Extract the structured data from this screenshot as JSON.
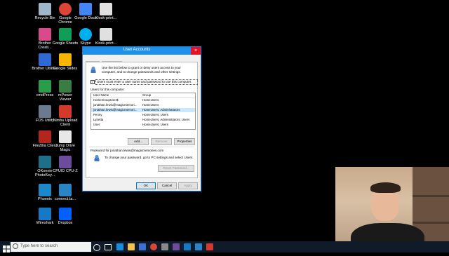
{
  "desktop": {
    "icons": [
      {
        "label": "Recycle Bin",
        "color": "#9fb7c9"
      },
      {
        "label": "Google Chrome",
        "color": "#db4437"
      },
      {
        "label": "Google Docs",
        "color": "#4285f4"
      },
      {
        "label": "Kiosk-print...",
        "color": "#e0e0e0"
      },
      {
        "label": "Brother Creati...",
        "color": "#d84a8a"
      },
      {
        "label": "Google Sheets",
        "color": "#0f9d58"
      },
      {
        "label": "Skype",
        "color": "#00aff0"
      },
      {
        "label": "Kiosk-print...",
        "color": "#e0e0e0"
      },
      {
        "label": "Brother Utilities",
        "color": "#2e6ad1"
      },
      {
        "label": "Google Slides",
        "color": "#f4b400"
      },
      {
        "label": "Kiosk-print...",
        "color": "#e0e0e0"
      },
      {
        "label": "cmdPress",
        "color": "#2a9d4a"
      },
      {
        "label": "mPower Viewer",
        "color": "#3a7d44"
      },
      {
        "label": "FOS Utility",
        "color": "#6b7a8f"
      },
      {
        "label": "Nimbu Upload Client",
        "color": "#d33a2c"
      },
      {
        "label": "FileZilla Client",
        "color": "#b3261e"
      },
      {
        "label": "Jump Drive Magic",
        "color": "#e8e8e8"
      },
      {
        "label": "OKonnie PhotoKey...",
        "color": "#1f6f8b"
      },
      {
        "label": "CPUID CPU-Z",
        "color": "#6d4c9c"
      },
      {
        "label": "Phoenix",
        "color": "#1c87c9"
      },
      {
        "label": "connect.ta...",
        "color": "#2b84c6"
      },
      {
        "label": "Wireshark",
        "color": "#1679c5"
      },
      {
        "label": "Dropbox",
        "color": "#0061fe"
      }
    ]
  },
  "dialog": {
    "title": "User Accounts",
    "close": "×",
    "tabs": [
      "Users",
      "Advanced"
    ],
    "intro": "Use the list below to grant or deny users access to your computer, and to change passwords and other settings.",
    "must_enter_checkbox": "Users must enter a user name and password to use this computer.",
    "users_label": "Users for this computer:",
    "columns": [
      "User Name",
      "Group"
    ],
    "rows": [
      {
        "name": "HomeGroupUser$",
        "group": "HomeUsers"
      },
      {
        "name": "jonathan.lewis@magicmemori...",
        "group": "HomeUsers"
      },
      {
        "name": "jonathan.lewis@magicmemori...",
        "group": "HomeUsers; Administrators"
      },
      {
        "name": "Penny",
        "group": "HomeUsers; Users"
      },
      {
        "name": "Lynetta",
        "group": "HomeUsers; Administrators; Users"
      },
      {
        "name": "User",
        "group": "HomeUsers; Users"
      }
    ],
    "buttons": {
      "add": "Add...",
      "remove": "Remove",
      "properties": "Properties"
    },
    "password_for": "Password for jonathan.lewis@magicmemories.com",
    "password_hint": "To change your password, go to PC settings and select Users.",
    "reset_password": "Reset Password...",
    "footer": {
      "ok": "OK",
      "cancel": "Cancel",
      "apply": "Apply"
    }
  },
  "taskbar": {
    "search_placeholder": "Type here to search"
  }
}
